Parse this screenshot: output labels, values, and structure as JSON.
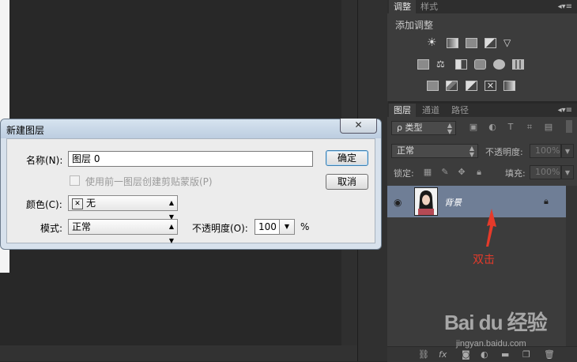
{
  "adjustments_panel": {
    "tabs": [
      "调整",
      "样式"
    ],
    "title": "添加调整",
    "menu_glyph": "◂▾≡",
    "row1_icons": [
      "brightness-contrast-icon",
      "levels-icon",
      "curves-icon",
      "exposure-icon",
      "vibrance-icon"
    ],
    "row2_icons": [
      "hue-saturation-icon",
      "color-balance-icon",
      "black-white-icon",
      "photo-filter-icon",
      "channel-mixer-icon",
      "color-lookup-icon"
    ],
    "row3_icons": [
      "invert-icon",
      "posterize-icon",
      "threshold-icon",
      "selective-color-icon",
      "gradient-map-icon"
    ]
  },
  "layers_panel": {
    "tabs": [
      "图层",
      "通道",
      "路径"
    ],
    "filter_type": "ρ 类型",
    "blend_mode": "正常",
    "opacity_label": "不透明度:",
    "opacity_value": "100%",
    "lock_label": "锁定:",
    "fill_label": "填充:",
    "fill_value": "100%",
    "layer_name": "背景",
    "annotation": "双击",
    "footer_icons": [
      "link-icon",
      "fx-icon",
      "mask-icon",
      "adjustment-icon",
      "folder-icon",
      "new-layer-icon",
      "trash-icon"
    ],
    "footer_fx": "fx"
  },
  "dialog": {
    "title": "新建图层",
    "close_glyph": "✕",
    "name_label": "名称(N):",
    "name_value": "图层 0",
    "clip_label": "使用前一图层创建剪贴蒙版(P)",
    "color_label": "颜色(C):",
    "color_value": "无",
    "color_swatch": "✕",
    "mode_label": "模式:",
    "mode_value": "正常",
    "opacity_label": "不透明度(O):",
    "opacity_value": "100",
    "percent": "%",
    "ok_label": "确定",
    "cancel_label": "取消"
  },
  "watermark": {
    "logo": "Bai du 经验",
    "url": "jingyan.baidu.com"
  },
  "colors": {
    "annotation": "#e53a2a",
    "selected_layer": "#6f7e96",
    "dialog_frame": "#d7e1ec"
  }
}
